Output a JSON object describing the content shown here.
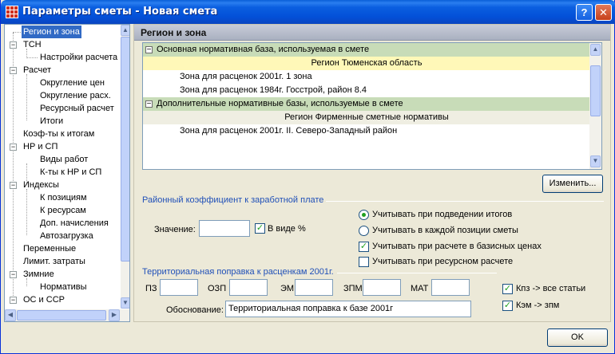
{
  "window": {
    "title": "Параметры сметы - Новая смета"
  },
  "tree": {
    "items": [
      {
        "label": "Регион и зона",
        "selected": true
      },
      {
        "label": "ТСН"
      },
      {
        "label": "Настройки расчета"
      },
      {
        "label": "Расчет"
      },
      {
        "label": "Округление цен"
      },
      {
        "label": "Округление расх."
      },
      {
        "label": "Ресурсный расчет"
      },
      {
        "label": "Итоги"
      },
      {
        "label": "Коэф-ты к итогам"
      },
      {
        "label": "НР и СП"
      },
      {
        "label": "Виды работ"
      },
      {
        "label": "К-ты к НР и СП"
      },
      {
        "label": "Индексы"
      },
      {
        "label": "К позициям"
      },
      {
        "label": "К ресурсам"
      },
      {
        "label": "Доп. начисления"
      },
      {
        "label": "Автозагрузка"
      },
      {
        "label": "Переменные"
      },
      {
        "label": "Лимит. затраты"
      },
      {
        "label": "Зимние"
      },
      {
        "label": "Нормативы"
      },
      {
        "label": "ОС и ССР"
      }
    ]
  },
  "panel": {
    "header": "Регион и зона"
  },
  "grid": {
    "rows": [
      {
        "type": "group",
        "text": "Основная нормативная база, используемая в смете"
      },
      {
        "type": "region",
        "text": "Регион Тюменская область"
      },
      {
        "type": "zone",
        "text": "Зона для расценок 2001г. 1 зона"
      },
      {
        "type": "zone",
        "text": "Зона для расценок 1984г. Госстрой, район 8.4"
      },
      {
        "type": "group",
        "text": "Дополнительные нормативные базы, используемые в смете"
      },
      {
        "type": "region2",
        "text": "Регион Фирменные сметные нормативы"
      },
      {
        "type": "zone",
        "text": "Зона для расценок 2001г. II. Северо-Западный район"
      }
    ]
  },
  "change_button": "Изменить...",
  "district": {
    "title": "Районный коэффициент к заработной плате",
    "value_label": "Значение:",
    "value": "",
    "percent_label": "В виде %",
    "percent_checked": true,
    "radio1": "Учитывать при подведении итогов",
    "radio1_checked": true,
    "radio2": "Учитывать в каждой позиции сметы",
    "radio2_checked": false,
    "chk_basic": "Учитывать при расчете в базисных ценах",
    "chk_basic_checked": true,
    "chk_resource": "Учитывать при ресурсном расчете",
    "chk_resource_checked": false
  },
  "territorial": {
    "title": "Территориальная поправка к расценкам 2001г.",
    "pz_label": "ПЗ",
    "ozp_label": "ОЗП",
    "em_label": "ЭМ",
    "zpm_label": "ЗПМ",
    "mat_label": "МАТ",
    "pz": "",
    "ozp": "",
    "em": "",
    "zpm": "",
    "mat": "",
    "kpz_label": "Кпз -> все статьи",
    "kpz_checked": true,
    "kem_label": "Кэм -> зпм",
    "kem_checked": true,
    "basis_label": "Обоснование:",
    "basis_value": "Территориальная поправка к базе 2001г"
  },
  "ok_button": "OK"
}
